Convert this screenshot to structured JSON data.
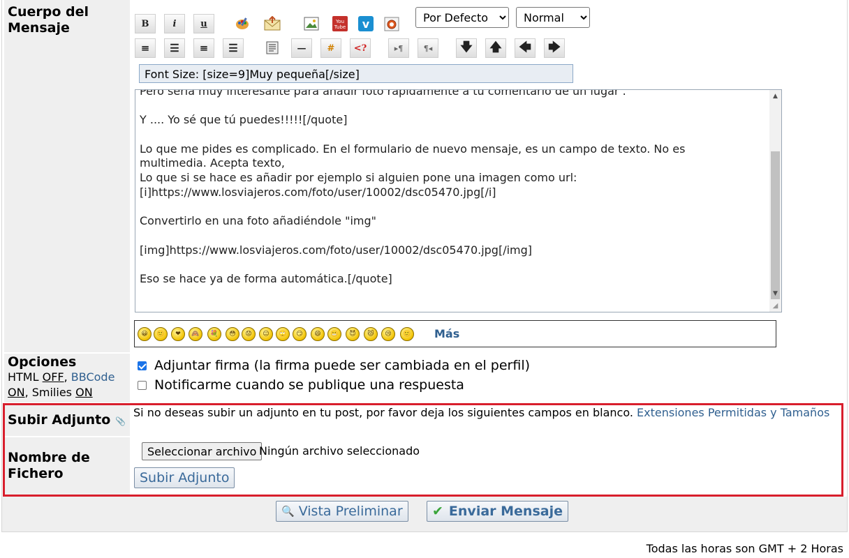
{
  "labels": {
    "body": "Cuerpo del Mensaje",
    "options": "Opciones",
    "attach": "Subir Adjunto",
    "filename": "Nombre de Fichero"
  },
  "toolbar": {
    "bold": "B",
    "italic": "i",
    "underline": "u",
    "hr": "—",
    "hash": "#",
    "code": "<?",
    "font_select": "Por Defecto",
    "size_select": "Normal",
    "helpline": "Font Size: [size=9]Muy pequeña[/size]",
    "icons_row1": [
      "color-palette-icon",
      "envelope-icon",
      "image-icon",
      "youtube-icon",
      "vimeo-icon",
      "flash-icon"
    ],
    "icons_row2": [
      "align-justify-icon",
      "align-left-icon",
      "align-center-icon",
      "align-right-icon",
      "list-icon",
      "hr-icon",
      "hash-icon",
      "code-icon",
      "ltr-icon",
      "rtl-icon",
      "arrow-down-icon",
      "arrow-up-icon",
      "arrow-left-icon",
      "arrow-right-icon"
    ]
  },
  "editor": {
    "lines": [
      "Pero sería muy interesante para añadir foto rápidamente a tu comentario de un lugar .",
      "",
      "Y .... Yo sé que tú puedes!!!!![/quote]",
      "",
      "Lo que me pides es complicado. En el formulario de nuevo mensaje, es un campo de texto. No es",
      "multimedia. Acepta texto,",
      "Lo que si se hace es añadir por ejemplo si alguien pone una imagen como url:",
      "[i]https://www.losviajeros.com/foto/user/10002/dsc05470.jpg[/i]",
      "",
      "Convertirlo en una foto añadiéndole \"img\"",
      "",
      "[img]https://www.losviajeros.com/foto/user/10002/dsc05470.jpg[/img]",
      "",
      "Eso se hace ya de forma automática.[/quote]"
    ]
  },
  "smilies": {
    "items": [
      "😀",
      "🙂",
      "❤",
      "🙈",
      "💐",
      "😳",
      "😟",
      "😐",
      "🙄",
      "😏",
      "😄",
      "😬",
      "😈",
      "😾",
      "😢",
      "🙂"
    ],
    "more": "Más"
  },
  "options": {
    "html_label": "HTML",
    "html_state": "OFF",
    "bbcode_label": "BBCode",
    "bbcode_state": "ON",
    "smilies_label": "Smilies",
    "smilies_state": "ON",
    "attach_signature": "Adjuntar firma (la firma puede ser cambiada en el perfil)",
    "attach_signature_checked": true,
    "notify": "Notificarme cuando se publique una respuesta",
    "notify_checked": false
  },
  "attach": {
    "notice": "Si no deseas subir un adjunto en tu post, por favor deja los siguientes campos en blanco.",
    "extensions_link": "Extensiones Permitidas y Tamaños",
    "select_file": "Seleccionar archivo",
    "no_file": "Ningún archivo seleccionado",
    "upload_button": "Subir Adjunto"
  },
  "actions": {
    "preview": "Vista Preliminar",
    "send": "Enviar Mensaje"
  },
  "footer": "Todas las horas son GMT + 2 Horas",
  "colors": {
    "highlight_box": "#d81e2c",
    "link": "#2f5f8f",
    "label_bg": "#efefef"
  }
}
